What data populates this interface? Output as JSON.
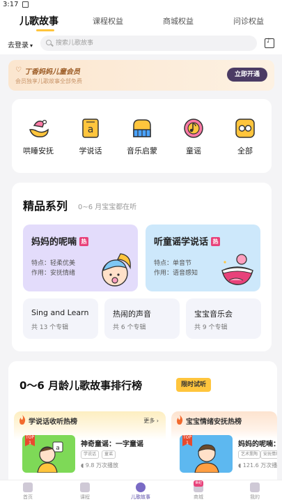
{
  "status_bar": {
    "time": "3:17"
  },
  "top_tabs": [
    {
      "label": "儿歌故事",
      "active": true
    },
    {
      "label": "课程权益",
      "active": false
    },
    {
      "label": "商城权益",
      "active": false
    },
    {
      "label": "问诊权益",
      "active": false
    }
  ],
  "search": {
    "login_label": "去登录",
    "placeholder": "搜索儿歌故事"
  },
  "vip": {
    "title": "丁香妈妈儿童会员",
    "subtitle": "会员独享儿歌故事全部免费",
    "button": "立即开通"
  },
  "categories": [
    {
      "label": "哄睡安抚",
      "icon": "moon-icon"
    },
    {
      "label": "学说话",
      "icon": "letter-a-icon"
    },
    {
      "label": "音乐启蒙",
      "icon": "piano-icon"
    },
    {
      "label": "童谣",
      "icon": "music-note-icon"
    },
    {
      "label": "全部",
      "icon": "grid-dots-icon"
    }
  ],
  "featured": {
    "title": "精品系列",
    "subtitle": "0~6 月宝宝都在听",
    "hot_label": "热",
    "big_cards": [
      {
        "title": "妈妈的呢喃",
        "feature_1": "特点：轻柔优美",
        "feature_2": "作用：安抚情绪",
        "color": "#e3dcfb"
      },
      {
        "title": "听童谣学说话",
        "feature_1": "特点：单音节",
        "feature_2": "作用：语音感知",
        "color": "#cde8fb"
      }
    ],
    "small_cards": [
      {
        "title": "Sing and Learn",
        "count": "共 13 个专辑"
      },
      {
        "title": "热闹的声音",
        "count": "共 6 个专辑"
      },
      {
        "title": "宝宝音乐会",
        "count": "共 9 个专辑"
      }
    ]
  },
  "ranking": {
    "title": "0～6 月龄儿歌故事排行榜",
    "badge": "限时试听",
    "lists": [
      {
        "header": "学说话收听热榜",
        "more": "更多 ›",
        "item": {
          "rank": "TOP 1",
          "title": "神奇童谣：一字童谣",
          "tags": [
            "学说话",
            "童谣"
          ],
          "plays": "9.8 万次播放"
        }
      },
      {
        "header": "宝宝情绪安抚热榜",
        "more": "",
        "item": {
          "rank": "TOP 1",
          "title": "妈妈的呢喃：治",
          "tags": [
            "艺术熏陶",
            "安抚情绪"
          ],
          "plays": "121.6 万次播放"
        }
      }
    ]
  },
  "bottom_nav": {
    "badge": "世纪",
    "items": [
      {
        "label": "首页",
        "active": false
      },
      {
        "label": "课程",
        "active": false
      },
      {
        "label": "儿歌故事",
        "active": true
      },
      {
        "label": "商城",
        "active": false
      },
      {
        "label": "我的",
        "active": false
      }
    ]
  }
}
